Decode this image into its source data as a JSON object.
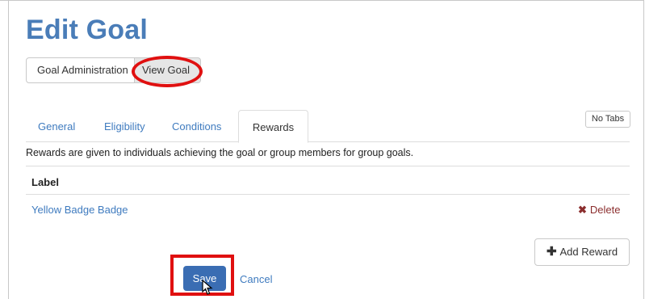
{
  "page": {
    "title": "Edit Goal"
  },
  "nav": {
    "goal_admin": "Goal Administration",
    "view_goal": "View Goal"
  },
  "notabs": "No Tabs",
  "tabs": [
    {
      "label": "General",
      "active": false
    },
    {
      "label": "Eligibility",
      "active": false
    },
    {
      "label": "Conditions",
      "active": false
    },
    {
      "label": "Rewards",
      "active": true
    }
  ],
  "rewards": {
    "description": "Rewards are given to individuals achieving the goal or group members for group goals.",
    "table_header": "Label",
    "rows": [
      {
        "label": "Yellow Badge Badge",
        "action": "Delete"
      }
    ],
    "add_label": "Add Reward"
  },
  "form": {
    "save": "Save",
    "cancel": "Cancel"
  },
  "colors": {
    "title": "#4a7db8",
    "link": "#3f7bbf",
    "primary": "#3a6db3",
    "annotation": "#e01010",
    "delete": "#8b2e2e"
  },
  "icons": {
    "delete": "x-icon",
    "add": "plus-icon",
    "cursor": "pointer-cursor-icon"
  }
}
